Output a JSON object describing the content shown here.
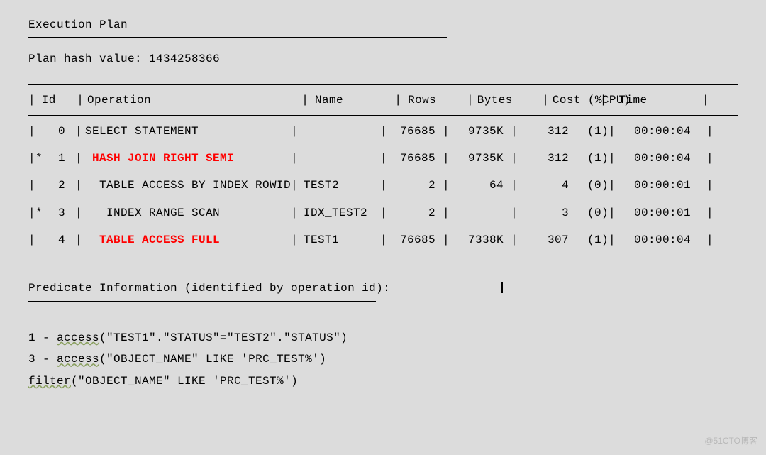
{
  "title": "Execution Plan",
  "hash_label": "Plan hash value: 1434258366",
  "headers": {
    "id": "Id",
    "operation": "Operation",
    "name": "Name",
    "rows": "Rows",
    "bytes": "Bytes",
    "cost": "Cost (%CPU)",
    "time": "Time"
  },
  "rows": [
    {
      "star": " ",
      "id": "0",
      "op": "SELECT STATEMENT",
      "indent": 0,
      "red": false,
      "name": "",
      "rows": "76685",
      "bytes": "9735K",
      "cost": "312",
      "pcpu": "(1)",
      "time": "00:00:04"
    },
    {
      "star": "*",
      "id": "1",
      "op": "HASH JOIN RIGHT SEMI",
      "indent": 1,
      "red": true,
      "name": "",
      "rows": "76685",
      "bytes": "9735K",
      "cost": "312",
      "pcpu": "(1)",
      "time": "00:00:04"
    },
    {
      "star": " ",
      "id": "2",
      "op": "TABLE ACCESS BY INDEX ROWID",
      "indent": 2,
      "red": false,
      "name": "TEST2",
      "rows": "2",
      "bytes": "64",
      "cost": "4",
      "pcpu": "(0)",
      "time": "00:00:01"
    },
    {
      "star": "*",
      "id": "3",
      "op": "INDEX RANGE SCAN",
      "indent": 3,
      "red": false,
      "name": "IDX_TEST2",
      "rows": "2",
      "bytes": "",
      "cost": "3",
      "pcpu": "(0)",
      "time": "00:00:01"
    },
    {
      "star": " ",
      "id": "4",
      "op": "TABLE ACCESS FULL",
      "indent": 2,
      "red": true,
      "name": "TEST1",
      "rows": "76685",
      "bytes": "7338K",
      "cost": "307",
      "pcpu": "(1)",
      "time": "00:00:04"
    }
  ],
  "pred_title": "Predicate Information (identified by operation id):",
  "predicates": [
    {
      "n": "1",
      "verb": "access",
      "body": "(\"TEST1\".\"STATUS\"=\"TEST2\".\"STATUS\")"
    },
    {
      "n": "3",
      "verb": "access",
      "body": "(\"OBJECT_NAME\" LIKE 'PRC_TEST%')"
    },
    {
      "n": "",
      "verb": "filter",
      "body": "(\"OBJECT_NAME\" LIKE 'PRC_TEST%')"
    }
  ],
  "watermark": "@51CTO博客"
}
